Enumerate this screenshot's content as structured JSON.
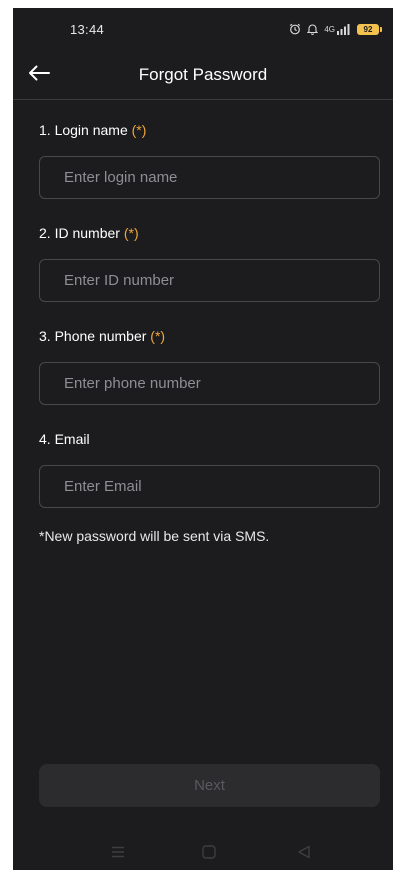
{
  "status_bar": {
    "time": "13:44",
    "network": "4G",
    "battery": "92",
    "icons": [
      "alarm-icon",
      "bell-icon",
      "signal-icon",
      "battery-icon"
    ]
  },
  "header": {
    "title": "Forgot Password",
    "back_icon": "arrow-left-icon"
  },
  "form": {
    "fields": [
      {
        "label": "1. Login name",
        "required_mark": "(*)",
        "placeholder": "Enter login name"
      },
      {
        "label": "2. ID number",
        "required_mark": "(*)",
        "placeholder": "Enter ID number"
      },
      {
        "label": "3. Phone number",
        "required_mark": "(*)",
        "placeholder": "Enter phone number"
      },
      {
        "label": "4. Email",
        "required_mark": "",
        "placeholder": "Enter Email"
      }
    ],
    "note": "*New password will be sent via SMS."
  },
  "actions": {
    "next_label": "Next"
  },
  "nav_bar": {
    "icons": [
      "menu-icon",
      "home-icon",
      "back-triangle-icon"
    ]
  },
  "colors": {
    "background": "#1c1c1e",
    "required_accent": "#f0a63c",
    "input_border": "#48484a",
    "disabled_button": "#2c2c2e"
  }
}
